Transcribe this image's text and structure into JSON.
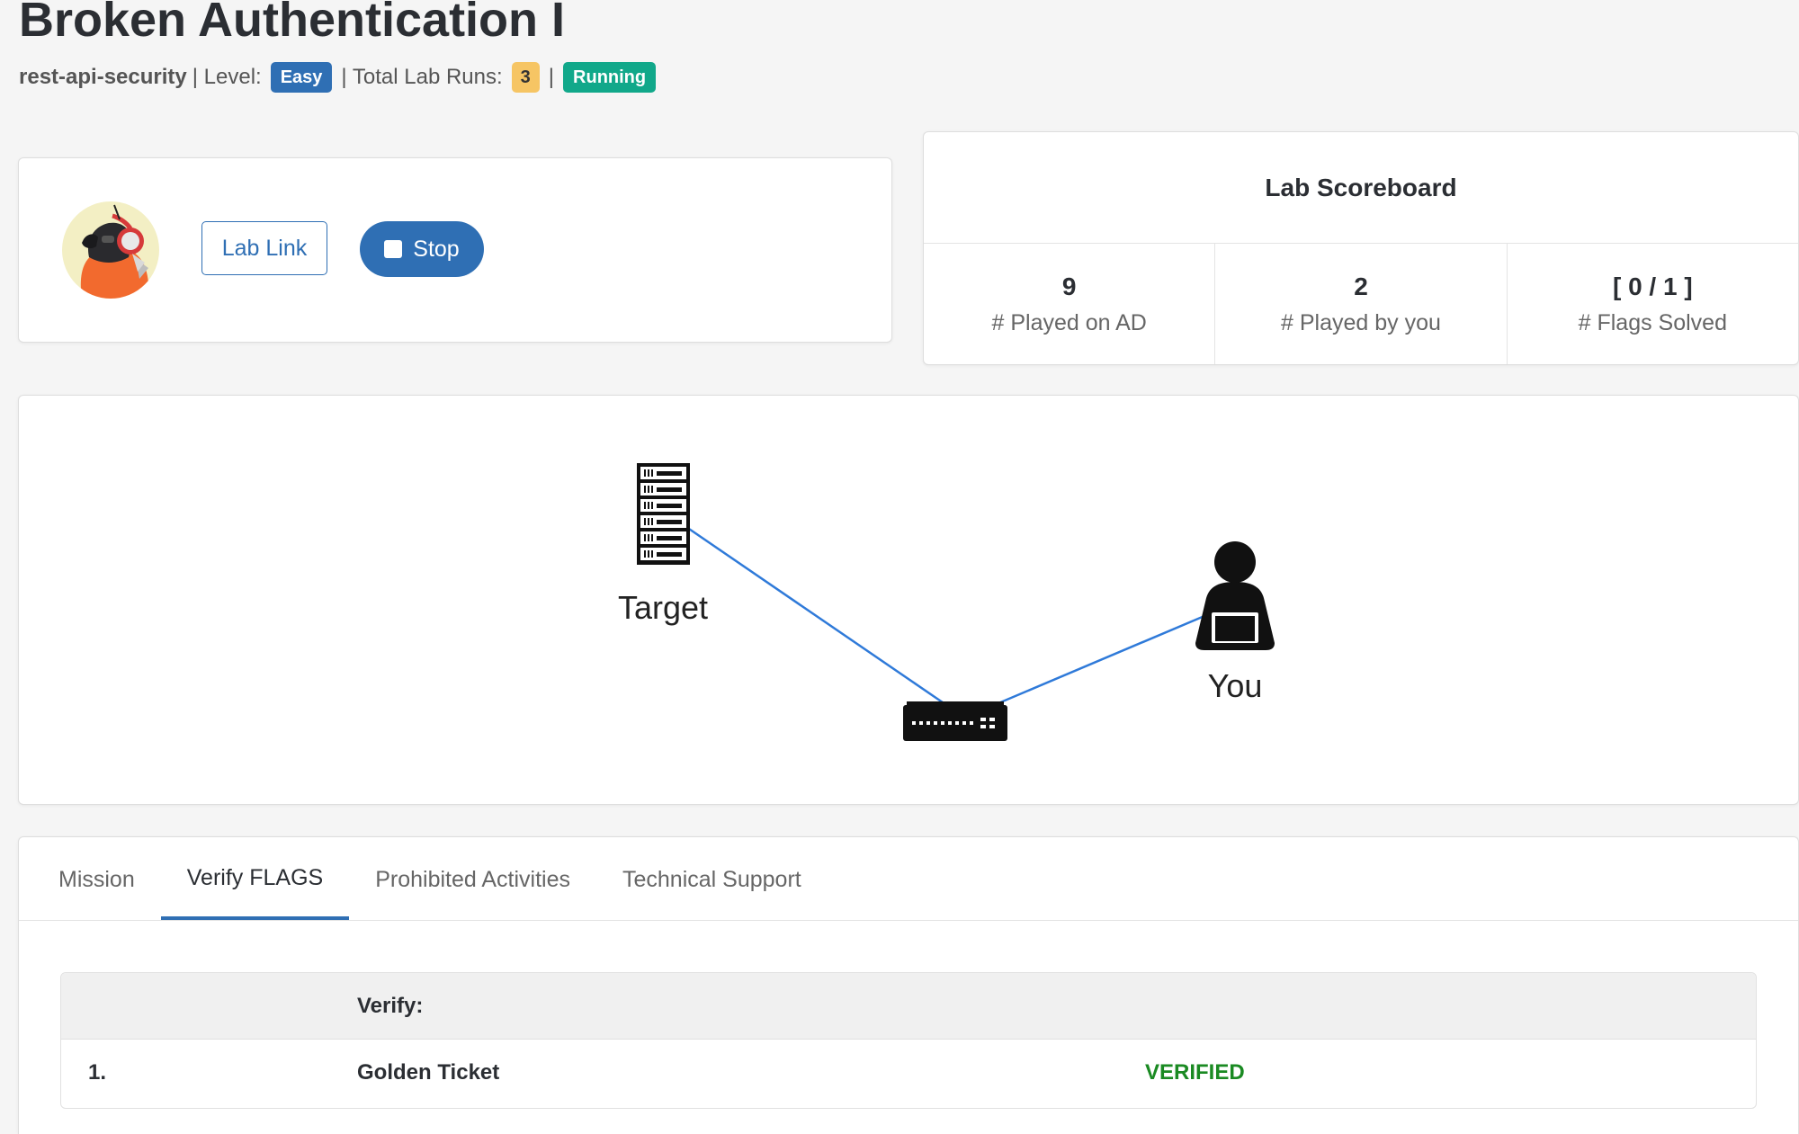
{
  "header": {
    "title": "Broken Authentication I",
    "course": "rest-api-security",
    "level_prefix": "| Level:",
    "level": "Easy",
    "runs_prefix": "| Total Lab Runs:",
    "runs": "3",
    "runs_suffix": "|",
    "status": "Running"
  },
  "actions": {
    "lab_link_label": "Lab Link",
    "stop_label": "Stop"
  },
  "scoreboard": {
    "title": "Lab Scoreboard",
    "stats": [
      {
        "value": "9",
        "label": "# Played on AD"
      },
      {
        "value": "2",
        "label": "# Played by you"
      },
      {
        "value": "[ 0 / 1 ]",
        "label": "# Flags Solved"
      }
    ]
  },
  "diagram": {
    "target_label": "Target",
    "you_label": "You",
    "icons": [
      "server-icon",
      "network-switch-icon",
      "user-laptop-icon"
    ],
    "link_color": "#2f7ad9"
  },
  "tabs": [
    {
      "label": "Mission",
      "active": false
    },
    {
      "label": "Verify FLAGS",
      "active": true
    },
    {
      "label": "Prohibited Activities",
      "active": false
    },
    {
      "label": "Technical Support",
      "active": false
    }
  ],
  "verify": {
    "header": "Verify:",
    "rows": [
      {
        "index": "1.",
        "name": "Golden Ticket",
        "status": "VERIFIED"
      }
    ]
  },
  "colors": {
    "primary": "#2f6fb4",
    "status_running": "#11a88a",
    "runs_badge": "#f6c564",
    "verified": "#1a8a22"
  }
}
